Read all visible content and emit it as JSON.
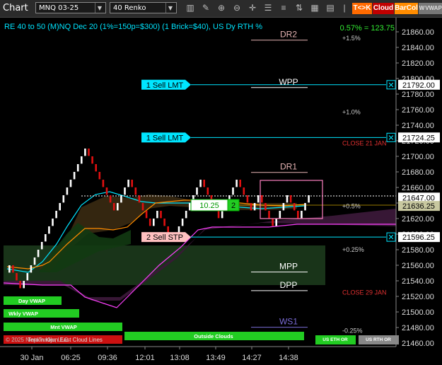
{
  "window": {
    "title": "Chart"
  },
  "toolbar": {
    "instrument": "MNQ 03-25",
    "bar_type": "40 Renko",
    "btn_tk": "T<>K",
    "btn_cloud": "Cloud",
    "btn_barcol": "BarCol",
    "btn_w": "W",
    "btn_vwap": "VWAP"
  },
  "chart_info": {
    "header": "RE 40 to 50 (M)NQ Dec 20 (1%=150p=$300) (1 Brick=$40), US Dy RTH %",
    "change_readout": "0.57% = 123.75",
    "copyright": "© 2025 NinjaTrader, LLC",
    "watermark": "Tenkin Kijun East Cloud Lines"
  },
  "price_axis": {
    "ticks": [
      "21860.00",
      "21840.00",
      "21820.00",
      "21800.00",
      "21780.00",
      "21760.00",
      "21740.00",
      "21720.00",
      "21700.00",
      "21680.00",
      "21660.00",
      "21640.00",
      "21620.00",
      "21600.00",
      "21580.00",
      "21560.00",
      "21540.00",
      "21520.00",
      "21500.00",
      "21480.00",
      "21460.00"
    ],
    "flags": [
      {
        "text": "21792.00",
        "price": 21792,
        "bg": "#ffffff",
        "fg": "#000000"
      },
      {
        "text": "21724.25",
        "price": 21724.25,
        "bg": "#ffffff",
        "fg": "#000000"
      },
      {
        "text": "21647.00",
        "price": 21647,
        "bg": "#ffffff",
        "fg": "#000000"
      },
      {
        "text": "21636.25",
        "price": 21636.25,
        "bg": "#c8c8a0",
        "fg": "#000000"
      },
      {
        "text": "21596.25",
        "price": 21596.25,
        "bg": "#ffffff",
        "fg": "#000000"
      }
    ]
  },
  "time_axis": {
    "labels": [
      "30 Jan",
      "06:25",
      "09:36",
      "12:01",
      "13:08",
      "13:49",
      "14:27",
      "14:38"
    ]
  },
  "levels": [
    {
      "label": "DR2",
      "price": 21853,
      "color": "#e6b4b4"
    },
    {
      "label": "WPP",
      "price": 21792,
      "color": "#ffffff"
    },
    {
      "label": "DR1",
      "price": 21683,
      "color": "#e6b4b4"
    },
    {
      "label": "MPP",
      "price": 21555,
      "color": "#ffffff"
    },
    {
      "label": "DPP",
      "price": 21531,
      "color": "#ffffff"
    },
    {
      "label": "WS1",
      "price": 21484,
      "color": "#7a6bd6"
    }
  ],
  "pct_labels": [
    {
      "text": "+1.5%",
      "price": 21852,
      "color": "#cccccc"
    },
    {
      "text": "+1.0%",
      "price": 21757,
      "color": "#cccccc"
    },
    {
      "text": "CLOSE 21 JAN",
      "price": 21717,
      "color": "#e03030"
    },
    {
      "text": "+0.5%",
      "price": 21636,
      "color": "#cccccc"
    },
    {
      "text": "+0.25%",
      "price": 21580,
      "color": "#cccccc"
    },
    {
      "text": "CLOSE 29 JAN",
      "price": 21525,
      "color": "#e03030"
    },
    {
      "text": "-0.25%",
      "price": 21476,
      "color": "#cccccc"
    }
  ],
  "orders": [
    {
      "label": "1 Sell LMT",
      "price": 21792,
      "bg": "#00e5ff",
      "line": "#00e5ff"
    },
    {
      "label": "1 Sell LMT",
      "price": 21724.25,
      "bg": "#00e5ff",
      "line": "#00e5ff"
    },
    {
      "label": "2 Sell STP",
      "price": 21596.25,
      "bg": "#ffc0c0",
      "line": "#00e5ff"
    }
  ],
  "position": {
    "pnl": "10.25",
    "qty": "2",
    "price": 21636.25
  },
  "vwap_labels": [
    "Day VWAP",
    "Wkly VWAP",
    "Mnt VWAP"
  ],
  "cloud_label": "Outside Clouds",
  "session_buttons": {
    "eth": "US ETH OR",
    "rth": "US RTH OR"
  },
  "colors": {
    "up_brick": "#ffffff",
    "down_brick": "#e01010",
    "cyan": "#00e5ff",
    "orange": "#ff8c00",
    "magenta": "#ff40ff"
  },
  "chart_data": {
    "type": "renko",
    "brick_size": 10,
    "closes": [
      21560,
      21550,
      21540,
      21530,
      21540,
      21550,
      21560,
      21570,
      21580,
      21590,
      21600,
      21610,
      21620,
      21630,
      21640,
      21650,
      21660,
      21670,
      21680,
      21690,
      21700,
      21710,
      21700,
      21690,
      21680,
      21670,
      21660,
      21650,
      21640,
      21630,
      21640,
      21650,
      21660,
      21670,
      21660,
      21650,
      21640,
      21630,
      21620,
      21610,
      21620,
      21630,
      21620,
      21610,
      21600,
      21590,
      21600,
      21610,
      21620,
      21630,
      21640,
      21650,
      21660,
      21670,
      21660,
      21650,
      21640,
      21630,
      21620,
      21630,
      21640,
      21650,
      21660,
      21670,
      21660,
      21650,
      21640,
      21630,
      21640,
      21650,
      21640,
      21630,
      21620,
      21610,
      21620,
      21630,
      21640,
      21650,
      21640,
      21630,
      21620,
      21630,
      21640,
      21650
    ],
    "ylim": [
      21455,
      21870
    ]
  }
}
